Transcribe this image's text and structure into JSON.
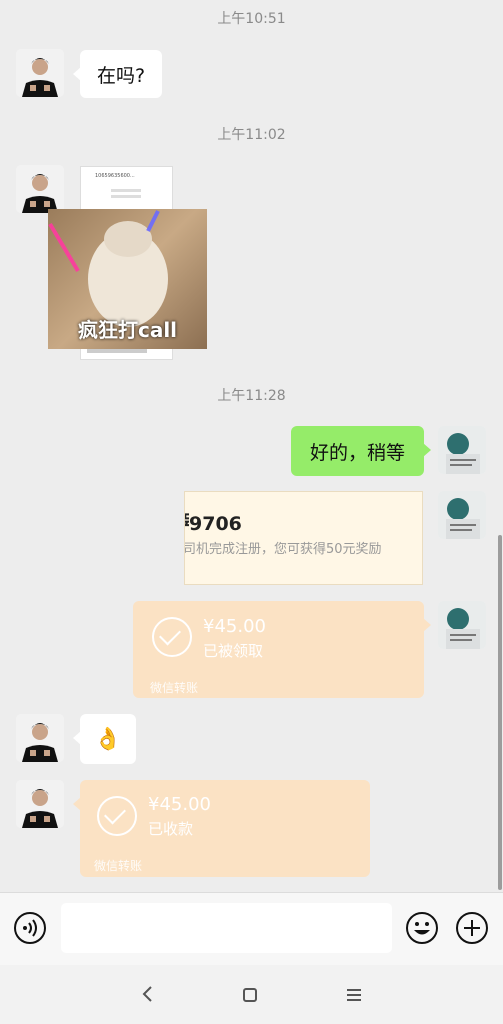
{
  "timestamps": [
    "上午10:51",
    "上午11:02",
    "上午11:28"
  ],
  "messages": {
    "m1_text": "在吗?",
    "sticker_caption": "疯狂打call",
    "screenshot_number": "10659635600...",
    "m2_text": "好的，稍等",
    "card_code": "9706",
    "card_desc": "司机完成注册，您可获得50元奖励",
    "transfer_out": {
      "amount": "¥45.00",
      "status": "已被领取",
      "footer": "微信转账"
    },
    "emoji_label": "👌",
    "transfer_in": {
      "amount": "¥45.00",
      "status": "已收款",
      "footer": "微信转账"
    }
  },
  "input": {
    "placeholder": ""
  },
  "colors": {
    "green_bubble": "#95ec69",
    "transfer_bg": "#fbe2c4",
    "background": "#ededed"
  },
  "icons": [
    "voice-icon",
    "emoji-icon",
    "plus-icon",
    "back-icon",
    "home-icon",
    "menu-icon"
  ]
}
